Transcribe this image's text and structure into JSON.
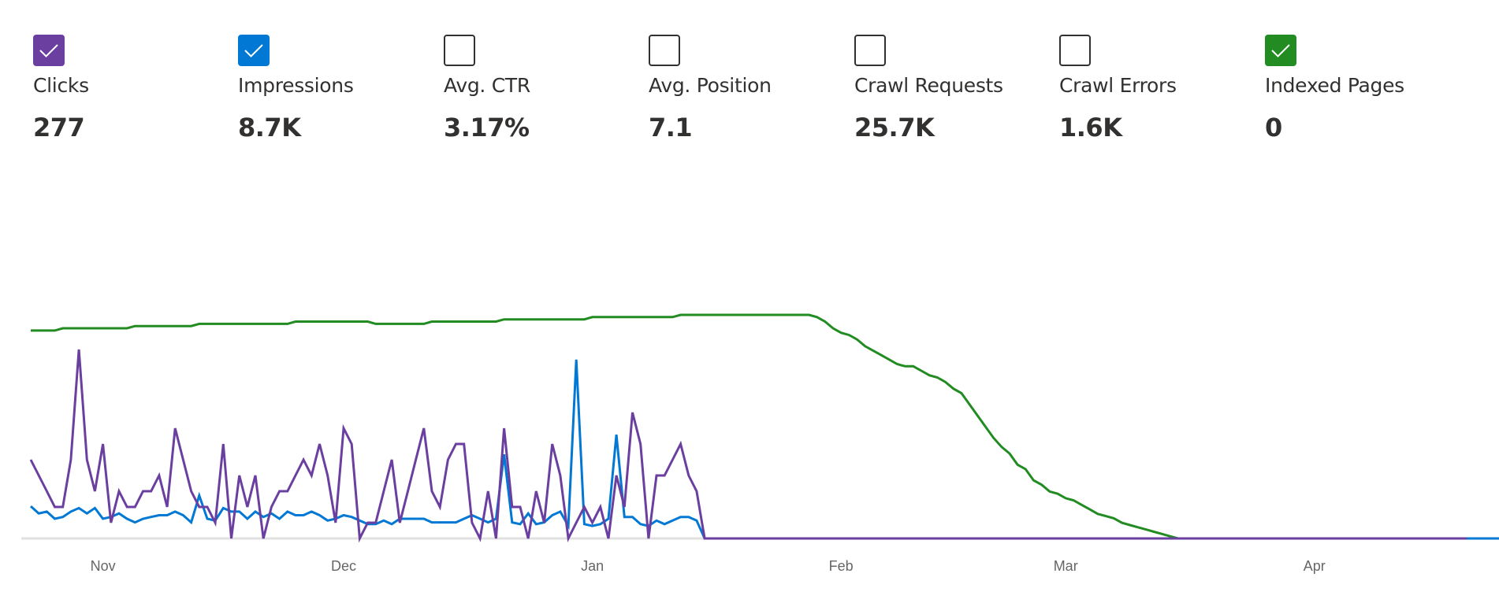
{
  "metrics": [
    {
      "label": "Clicks",
      "value": "277",
      "checked": true,
      "color": "#6b3fa0",
      "icon": "checkmark-icon"
    },
    {
      "label": "Impressions",
      "value": "8.7K",
      "checked": true,
      "color": "#0078d4",
      "icon": "checkmark-icon"
    },
    {
      "label": "Avg. CTR",
      "value": "3.17%",
      "checked": false,
      "color": "#323130",
      "icon": ""
    },
    {
      "label": "Avg. Position",
      "value": "7.1",
      "checked": false,
      "color": "#323130",
      "icon": ""
    },
    {
      "label": "Crawl Requests",
      "value": "25.7K",
      "checked": false,
      "color": "#323130",
      "icon": ""
    },
    {
      "label": "Crawl Errors",
      "value": "1.6K",
      "checked": false,
      "color": "#323130",
      "icon": ""
    },
    {
      "label": "Indexed Pages",
      "value": "0",
      "checked": true,
      "color": "#228b22",
      "icon": "checkmark-icon"
    }
  ],
  "chart_data": {
    "type": "line",
    "title": "",
    "xlabel": "",
    "ylabel": "",
    "grid": false,
    "legend": "none (series toggled by metric checkboxes above)",
    "x_start": "Oct 23",
    "x_unit": "day",
    "num_points": 181,
    "x_tick_labels": [
      {
        "label": "Nov",
        "day_index": 9
      },
      {
        "label": "Dec",
        "day_index": 39
      },
      {
        "label": "Jan",
        "day_index": 70
      },
      {
        "label": "Feb",
        "day_index": 101
      },
      {
        "label": "Mar",
        "day_index": 129
      },
      {
        "label": "Apr",
        "day_index": 160
      }
    ],
    "series": [
      {
        "name": "Indexed Pages",
        "unit": "relative (peak = 100)",
        "color": "#228b22",
        "ymax": 100,
        "values": [
          93,
          93,
          93,
          93,
          94,
          94,
          94,
          94,
          94,
          94,
          94,
          94,
          94,
          95,
          95,
          95,
          95,
          95,
          95,
          95,
          95,
          96,
          96,
          96,
          96,
          96,
          96,
          96,
          96,
          96,
          96,
          96,
          96,
          97,
          97,
          97,
          97,
          97,
          97,
          97,
          97,
          97,
          97,
          96,
          96,
          96,
          96,
          96,
          96,
          96,
          97,
          97,
          97,
          97,
          97,
          97,
          97,
          97,
          97,
          98,
          98,
          98,
          98,
          98,
          98,
          98,
          98,
          98,
          98,
          98,
          99,
          99,
          99,
          99,
          99,
          99,
          99,
          99,
          99,
          99,
          99,
          100,
          100,
          100,
          100,
          100,
          100,
          100,
          100,
          100,
          100,
          100,
          100,
          100,
          100,
          100,
          100,
          100,
          99,
          97,
          94,
          92,
          91,
          89,
          86,
          84,
          82,
          80,
          78,
          77,
          77,
          75,
          73,
          72,
          70,
          67,
          65,
          60,
          55,
          50,
          45,
          41,
          38,
          33,
          31,
          26,
          24,
          21,
          20,
          18,
          17,
          15,
          13,
          11,
          10,
          9,
          7,
          6,
          5,
          4,
          3,
          2,
          1,
          0,
          0,
          0,
          0,
          0,
          0,
          0,
          0,
          0,
          0,
          0,
          0,
          0,
          0,
          0,
          0,
          0,
          0,
          0,
          0,
          0,
          0,
          0,
          0,
          0,
          0,
          0,
          0,
          0,
          0,
          0,
          0,
          0,
          0,
          0,
          0,
          0,
          0
        ]
      },
      {
        "name": "Impressions",
        "unit": "relative (peak = 100)",
        "color": "#0078d4",
        "ymax": 125,
        "values": [
          18,
          14,
          15,
          11,
          12,
          15,
          17,
          14,
          17,
          11,
          12,
          14,
          11,
          9,
          11,
          12,
          13,
          13,
          15,
          13,
          9,
          24,
          11,
          10,
          17,
          15,
          15,
          11,
          15,
          12,
          14,
          11,
          15,
          13,
          13,
          15,
          13,
          10,
          11,
          13,
          12,
          10,
          8,
          8,
          10,
          8,
          11,
          11,
          11,
          11,
          9,
          9,
          9,
          9,
          11,
          13,
          11,
          9,
          11,
          47,
          9,
          8,
          14,
          8,
          9,
          13,
          15,
          7,
          100,
          8,
          7,
          8,
          11,
          58,
          12,
          12,
          8,
          7,
          10,
          8,
          10,
          12,
          12,
          10,
          0,
          0,
          0,
          0,
          0,
          0,
          0,
          0,
          0,
          0,
          0,
          0,
          0,
          0,
          0,
          0,
          0,
          0,
          0,
          0,
          0,
          0,
          0,
          0,
          0,
          0,
          0,
          0,
          0,
          0,
          0,
          0,
          0,
          0,
          0,
          0,
          0,
          0,
          0,
          0,
          0,
          0,
          0,
          0,
          0,
          0,
          0,
          0,
          0,
          0,
          0,
          0,
          0,
          0,
          0,
          0,
          0,
          0,
          0,
          0,
          0,
          0,
          0,
          0,
          0,
          0,
          0,
          0,
          0,
          0,
          0,
          0,
          0,
          0,
          0,
          0,
          0,
          0,
          0,
          0,
          0,
          0,
          0,
          0,
          0,
          0,
          0,
          0,
          0,
          0,
          0,
          0,
          0,
          0,
          0,
          0,
          0,
          0,
          0,
          0,
          0
        ]
      },
      {
        "name": "Clicks",
        "unit": "clicks",
        "color": "#6b3fa0",
        "ymax": 14.2,
        "values": [
          5,
          4,
          3,
          2,
          2,
          5,
          12,
          5,
          3,
          6,
          1,
          3,
          2,
          2,
          3,
          3,
          4,
          2,
          7,
          5,
          3,
          2,
          2,
          1,
          6,
          0,
          4,
          2,
          4,
          0,
          2,
          3,
          3,
          4,
          5,
          4,
          6,
          4,
          1,
          7,
          6,
          0,
          1,
          1,
          3,
          5,
          1,
          3,
          5,
          7,
          3,
          2,
          5,
          6,
          6,
          1,
          0,
          3,
          0,
          7,
          2,
          2,
          0,
          3,
          1,
          6,
          4,
          0,
          1,
          2,
          1,
          2,
          0,
          4,
          2,
          8,
          6,
          0,
          4,
          4,
          5,
          6,
          4,
          3,
          0,
          0,
          0,
          0,
          0,
          0,
          0,
          0,
          0,
          0,
          0,
          0,
          0,
          0,
          0,
          0,
          0,
          0,
          0,
          0,
          0,
          0,
          0,
          0,
          0,
          0,
          0,
          0,
          0,
          0,
          0,
          0,
          0,
          0,
          0,
          0,
          0,
          0,
          0,
          0,
          0,
          0,
          0,
          0,
          0,
          0,
          0,
          0,
          0,
          0,
          0,
          0,
          0,
          0,
          0,
          0,
          0,
          0,
          0,
          0,
          0,
          0,
          0,
          0,
          0,
          0,
          0,
          0,
          0,
          0,
          0,
          0,
          0,
          0,
          0,
          0,
          0,
          0,
          0,
          0,
          0,
          0,
          0,
          0,
          0,
          0,
          0,
          0,
          0,
          0,
          0,
          0,
          0,
          0,
          0,
          0
        ]
      }
    ]
  }
}
